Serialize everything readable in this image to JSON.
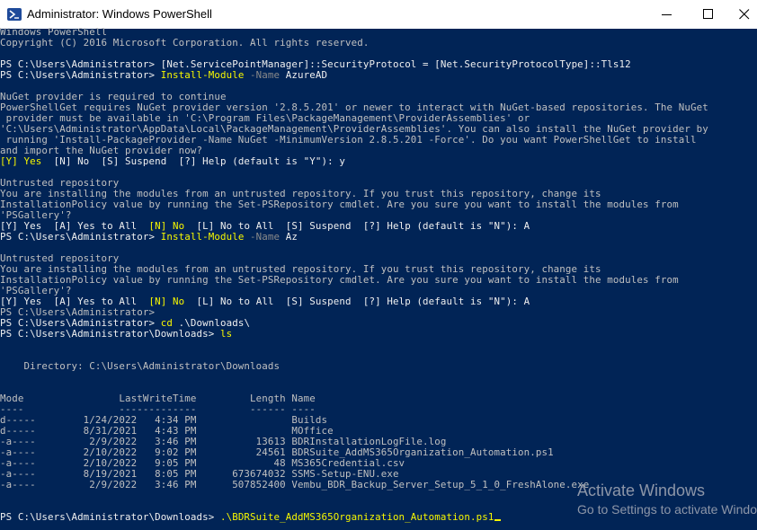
{
  "window": {
    "title": "Administrator: Windows PowerShell"
  },
  "console": {
    "lines": [
      "Windows PowerShell",
      "Copyright (C) 2016 Microsoft Corporation. All rights reserved.",
      "",
      [
        {
          "t": "PS C:\\Users\\Administrator> ",
          "c": "w"
        },
        {
          "t": "[Net.ServicePointManager]",
          "c": "w"
        },
        {
          "t": "::SecurityProtocol = ",
          "c": "w"
        },
        {
          "t": "[Net.SecurityProtocolType]",
          "c": "w"
        },
        {
          "t": "::Tls12",
          "c": "w"
        }
      ],
      [
        {
          "t": "PS C:\\Users\\Administrator> ",
          "c": "w"
        },
        {
          "t": "Install-Module",
          "c": "y"
        },
        {
          "t": " -Name ",
          "c": "g"
        },
        {
          "t": "AzureAD",
          "c": "w"
        }
      ],
      "",
      "NuGet provider is required to continue",
      "PowerShellGet requires NuGet provider version '2.8.5.201' or newer to interact with NuGet-based repositories. The NuGet",
      " provider must be available in 'C:\\Program Files\\PackageManagement\\ProviderAssemblies' or",
      "'C:\\Users\\Administrator\\AppData\\Local\\PackageManagement\\ProviderAssemblies'. You can also install the NuGet provider by",
      " running 'Install-PackageProvider -Name NuGet -MinimumVersion 2.8.5.201 -Force'. Do you want PowerShellGet to install",
      "and import the NuGet provider now?",
      [
        {
          "t": "[Y] Yes",
          "c": "y"
        },
        {
          "t": "  [N] No  [S] Suspend  [?] Help (default is \"Y\"): y",
          "c": "w"
        }
      ],
      "",
      "Untrusted repository",
      "You are installing the modules from an untrusted repository. If you trust this repository, change its",
      "InstallationPolicy value by running the Set-PSRepository cmdlet. Are you sure you want to install the modules from",
      "'PSGallery'?",
      [
        {
          "t": "[Y] Yes  [A] Yes to All  ",
          "c": "w"
        },
        {
          "t": "[N] No",
          "c": "y"
        },
        {
          "t": "  [L] No to All  [S] Suspend  [?] Help (default is \"N\"): A",
          "c": "w"
        }
      ],
      [
        {
          "t": "PS C:\\Users\\Administrator> ",
          "c": "w"
        },
        {
          "t": "Install-Module",
          "c": "y"
        },
        {
          "t": " -Name ",
          "c": "g"
        },
        {
          "t": "Az",
          "c": "w"
        }
      ],
      "",
      "Untrusted repository",
      "You are installing the modules from an untrusted repository. If you trust this repository, change its",
      "InstallationPolicy value by running the Set-PSRepository cmdlet. Are you sure you want to install the modules from",
      "'PSGallery'?",
      [
        {
          "t": "[Y] Yes  [A] Yes to All  ",
          "c": "w"
        },
        {
          "t": "[N] No",
          "c": "y"
        },
        {
          "t": "  [L] No to All  [S] Suspend  [?] Help (default is \"N\"): A",
          "c": "w"
        }
      ],
      "PS C:\\Users\\Administrator>",
      [
        {
          "t": "PS C:\\Users\\Administrator> ",
          "c": "w"
        },
        {
          "t": "cd",
          "c": "y"
        },
        {
          "t": " .\\Downloads\\",
          "c": "w"
        }
      ],
      [
        {
          "t": "PS C:\\Users\\Administrator\\Downloads> ",
          "c": "w"
        },
        {
          "t": "ls",
          "c": "y"
        }
      ],
      "",
      "",
      "    Directory: C:\\Users\\Administrator\\Downloads",
      "",
      "",
      "Mode                LastWriteTime         Length Name",
      "----                -------------         ------ ----",
      "d-----        1/24/2022   4:34 PM                Builds",
      "d-----        8/31/2021   4:43 PM                MOffice",
      "-a----         2/9/2022   3:46 PM          13613 BDRInstallationLogFile.log",
      "-a----        2/10/2022   9:02 PM          24561 BDRSuite_AddMS365Organization_Automation.ps1",
      "-a----        2/10/2022   9:05 PM             48 MS365Credential.csv",
      "-a----        8/19/2021   8:05 PM      673674032 SSMS-Setup-ENU.exe",
      "-a----         2/9/2022   3:46 PM      507852400 Vembu_BDR_Backup_Server_Setup_5_1_0_FreshAlone.exe",
      "",
      "",
      [
        {
          "t": "PS C:\\Users\\Administrator\\Downloads> ",
          "c": "w"
        },
        {
          "t": ".\\BDRSuite_AddMS365Organization_Automation.ps1",
          "c": "y"
        }
      ]
    ]
  },
  "watermark": {
    "line1": "Activate Windows",
    "line2": "Go to Settings to activate Windows."
  }
}
